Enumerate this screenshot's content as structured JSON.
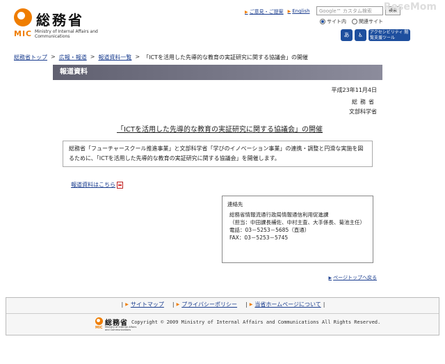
{
  "header": {
    "logo_ja": "総務省",
    "logo_mic": "MIC",
    "logo_en": "Ministry of Internal Affairs and Communications",
    "links": [
      {
        "label": "ご意見・ご提案"
      },
      {
        "label": "English"
      }
    ],
    "search": {
      "placeholder": "Google™ カスタム検索",
      "button": "検索"
    },
    "radio": [
      {
        "label": "サイト内",
        "selected": true
      },
      {
        "label": "関連サイト",
        "selected": false
      }
    ],
    "watermark": "ReseMom",
    "accessibility": {
      "icon1": "あ",
      "icon2": "♿",
      "label": "アクセシビリティ 閲覧支援ツール"
    }
  },
  "breadcrumb": [
    {
      "label": "総務省トップ",
      "link": true
    },
    {
      "label": "広報・報道",
      "link": true
    },
    {
      "label": "報道資料一覧",
      "link": true
    },
    {
      "label": "「ICTを活用した先導的な教育の実証研究に関する協議会」の開催",
      "link": false
    }
  ],
  "release_bar": "報道資料",
  "date": "平成23年11月4日",
  "issuer1": "総務省",
  "issuer2": "文部科学省",
  "headline": "「ICTを活用した先導的な教育の実証研究に関する協議会」の開催",
  "summary": "総務省「フューチャースクール推進事業」と文部科学省「学びのイノベーション事業」の連携・調整と円滑な実施を図るために、「ICTを活用した先導的な教育の実証研究に関する協議会」を開催します。",
  "release_link": "報道資料はこちら",
  "contact": {
    "title": "連絡先",
    "lines": [
      "総務省情報流通行政局情報通信利用促進課",
      "（担当：中田課長補佐、中村主査、大手係長、菊池主任）",
      "電話：03－5253－5685（直通）",
      "FAX：03－5253－5745"
    ]
  },
  "page_top": "ページトップへ戻る",
  "footer": {
    "nav": [
      {
        "label": "サイトマップ"
      },
      {
        "label": "プライバシーポリシー"
      },
      {
        "label": "当省ホームページについて"
      }
    ],
    "logo_ja": "総務省",
    "logo_mic": "MIC",
    "logo_en": "Ministry of Internal Affairs and Communications",
    "copyright": "Copyright © 2009 Ministry of Internal Affairs and Communications All Rights Reserved."
  }
}
